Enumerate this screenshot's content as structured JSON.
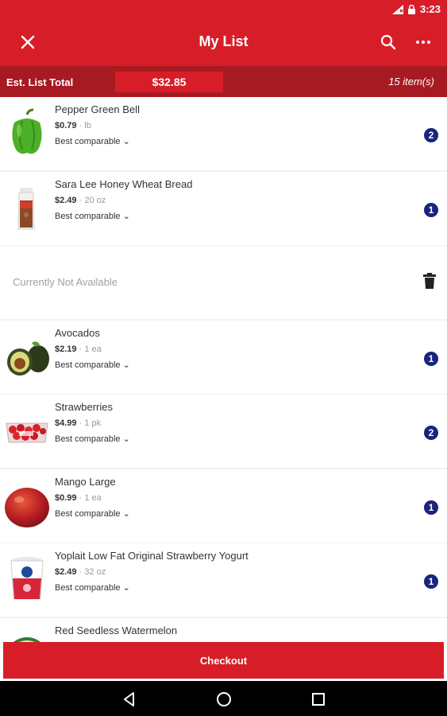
{
  "status_bar": {
    "time": "3:23"
  },
  "header": {
    "title": "My List",
    "close_icon": "close-icon",
    "search_icon": "search-icon",
    "more_icon": "more-horizontal-icon"
  },
  "summary": {
    "total_label": "Est. List Total",
    "total_value": "$32.85",
    "item_count": "15 item(s)"
  },
  "items": [
    {
      "name": "Pepper Green Bell",
      "price": "$0.79",
      "unit": "· lb",
      "comparable": "Best comparable",
      "qty": "2",
      "image": "green-pepper"
    },
    {
      "name": "Sara Lee Honey Wheat Bread",
      "price": "$2.49",
      "unit": "· 20 oz",
      "comparable": "Best comparable",
      "qty": "1",
      "image": "bread-loaf"
    },
    {
      "unavailable_text": "Currently Not Available",
      "icon": "trash-icon"
    },
    {
      "name": "Avocados",
      "price": "$2.19",
      "unit": "· 1 ea",
      "comparable": "Best comparable",
      "qty": "1",
      "image": "avocado"
    },
    {
      "name": "Strawberries",
      "price": "$4.99",
      "unit": "· 1 pk",
      "comparable": "Best comparable",
      "qty": "2",
      "image": "strawberries"
    },
    {
      "name": "Mango Large",
      "price": "$0.99",
      "unit": "· 1 ea",
      "comparable": "Best comparable",
      "qty": "1",
      "image": "mango"
    },
    {
      "name": "Yoplait Low Fat Original Strawberry Yogurt",
      "price": "$2.49",
      "unit": "· 32 oz",
      "comparable": "Best comparable",
      "qty": "1",
      "image": "yogurt-tub"
    },
    {
      "name": "Red Seedless Watermelon",
      "image": "watermelon"
    }
  ],
  "checkout": {
    "label": "Checkout"
  },
  "colors": {
    "brand_red": "#d71e28",
    "dark_red": "#a81a22",
    "qty_badge": "#1a237e"
  }
}
